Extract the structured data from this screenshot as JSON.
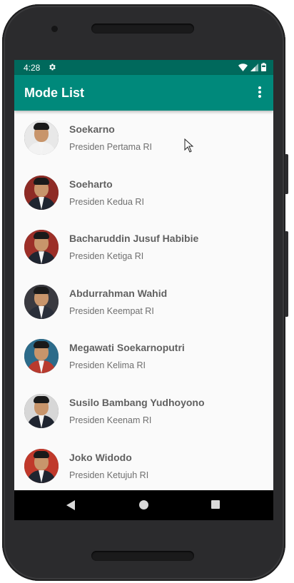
{
  "status_bar": {
    "time": "4:28",
    "icons": [
      "gear-icon",
      "wifi-icon",
      "signal-icon",
      "battery-icon"
    ]
  },
  "app_bar": {
    "title": "Mode List",
    "menu_icon": "overflow-menu-icon"
  },
  "list": {
    "items": [
      {
        "name": "Soekarno",
        "description": "Presiden Pertama RI",
        "avatar_bg": "#e8e8e8",
        "avatar_body": "#f2f2f2"
      },
      {
        "name": "Soeharto",
        "description": "Presiden Kedua RI",
        "avatar_bg": "#8e2b25",
        "avatar_body": "#1f2530"
      },
      {
        "name": "Bacharuddin Jusuf Habibie",
        "description": "Presiden Ketiga RI",
        "avatar_bg": "#9c2f28",
        "avatar_body": "#1f2530"
      },
      {
        "name": "Abdurrahman Wahid",
        "description": "Presiden Keempat RI",
        "avatar_bg": "#3a3a40",
        "avatar_body": "#2a2f3a"
      },
      {
        "name": "Megawati Soekarnoputri",
        "description": "Presiden Kelima RI",
        "avatar_bg": "#2c6b8a",
        "avatar_body": "#b83a2e"
      },
      {
        "name": "Susilo Bambang Yudhoyono",
        "description": "Presiden Keenam RI",
        "avatar_bg": "#d7d7d7",
        "avatar_body": "#1f2530"
      },
      {
        "name": "Joko Widodo",
        "description": "Presiden Ketujuh RI",
        "avatar_bg": "#c0392b",
        "avatar_body": "#1f2530"
      }
    ]
  },
  "nav_bar": {
    "icons": [
      "back-icon",
      "home-icon",
      "recents-icon"
    ]
  },
  "colors": {
    "status_bar": "#00695c",
    "app_bar": "#00897b",
    "background": "#fafafa",
    "primary_text": "#616161",
    "secondary_text": "#6f6f6f"
  }
}
